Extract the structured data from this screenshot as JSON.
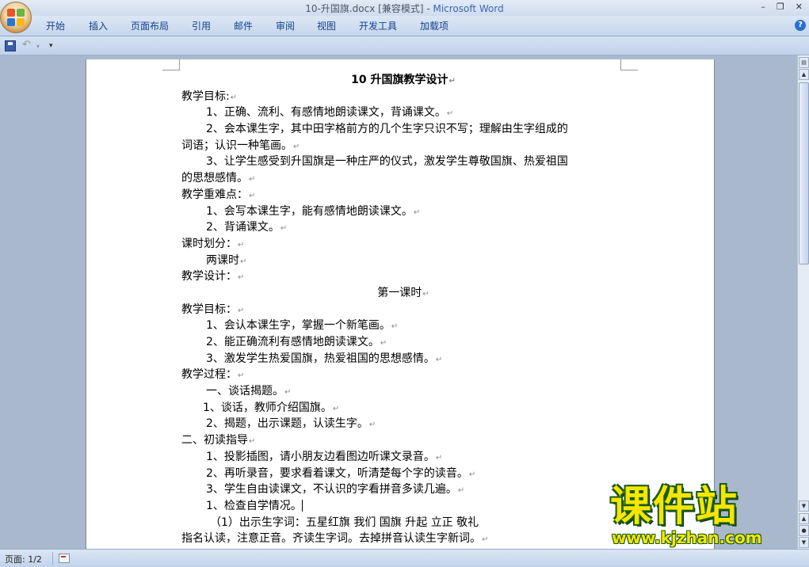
{
  "window": {
    "title_doc": "10-升国旗.docx [兼容模式] - ",
    "title_app": "Microsoft Word",
    "controls": [
      "–",
      "❐",
      "✕"
    ]
  },
  "ribbon": {
    "tabs": [
      "开始",
      "插入",
      "页面布局",
      "引用",
      "邮件",
      "审阅",
      "视图",
      "开发工具",
      "加载项"
    ],
    "help": "?"
  },
  "quick_access": {
    "undo": "↶",
    "more": "▾"
  },
  "document": {
    "title": "10  升国旗教学设计",
    "lines": [
      "教学目标:",
      "1、正确、流利、有感情地朗读课文，背诵课文。",
      "2、会本课生字，其中田字格前方的几个生字只识不写；理解由生字组成的",
      "词语；认识一种笔画。",
      "3、让学生感受到升国旗是一种庄严的仪式，激发学生尊敬国旗、热爱祖国",
      "的思想感情。",
      "教学重难点：",
      "1、会写本课生字，能有感情地朗读课文。",
      "2、背诵课文。",
      "课时划分：",
      "两课时",
      "教学设计：",
      "第一课时",
      "教学目标：",
      "1、会认本课生字，掌握一个新笔画。",
      "2、能正确流利有感情地朗读课文。",
      "3、激发学生热爱国旗，热爱祖国的思想感情。",
      "教学过程：",
      "一、谈话揭题。",
      "1、谈话，教师介绍国旗。",
      "2、揭题，出示课题，认读生字。",
      "二、初读指导",
      "1、投影插图，请小朋友边看图边听课文录音。",
      "2、再听录音，要求看着课文，听清楚每个字的读音。",
      "3、学生自由读课文，不认识的字看拼音多读几遍。",
      "1、检查自学情况。",
      "（1）出示生字词：五星红旗      我们      国旗     升起       立正       敬礼",
      "指名认读，注意正音。齐读生字词。去掉拼音认读生字新词。"
    ]
  },
  "status": {
    "page": "页面: 1/2"
  },
  "watermark": {
    "brand": "课件站",
    "url": "www.kjzhan.com"
  },
  "colors": {
    "ribbon_text": "#15428b",
    "watermark_fill": "#f5e600",
    "watermark_outline": "#1a5a1a"
  }
}
